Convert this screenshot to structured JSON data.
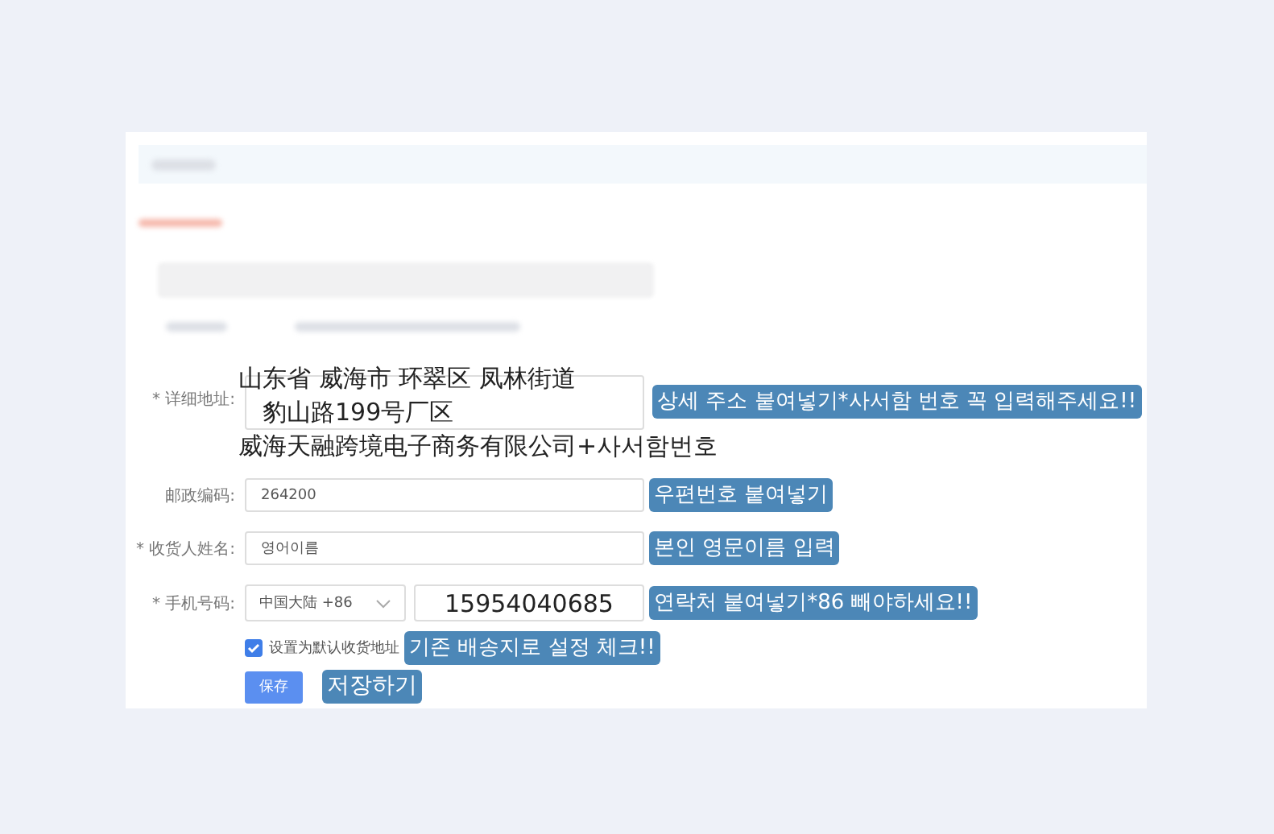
{
  "address": {
    "label": "* 详细地址:",
    "value_lines": [
      "山东省 威海市 环翠区 凤林街道",
      "豹山路199号厂区",
      "威海天融跨境电子商务有限公司+사서함번호"
    ],
    "note": "상세 주소 붙여넣기*사서함 번호 꼭 입력해주세요!!"
  },
  "postcode": {
    "label": "邮政编码:",
    "value": "264200",
    "note": "우편번호 붙여넣기"
  },
  "name": {
    "label": "* 收货人姓名:",
    "value": "영어이름",
    "note": "본인 영문이름 입력"
  },
  "phone": {
    "label": "* 手机号码:",
    "region": "中国大陆 +86",
    "value": "15954040685",
    "note": "연락처 붙여넣기*86 빼야하세요!!"
  },
  "default_checkbox": {
    "label": "设置为默认收货地址",
    "checked": true,
    "note": "기존 배송지로 설정 체크!!"
  },
  "save_button": {
    "label": "保存",
    "note": "저장하기"
  }
}
